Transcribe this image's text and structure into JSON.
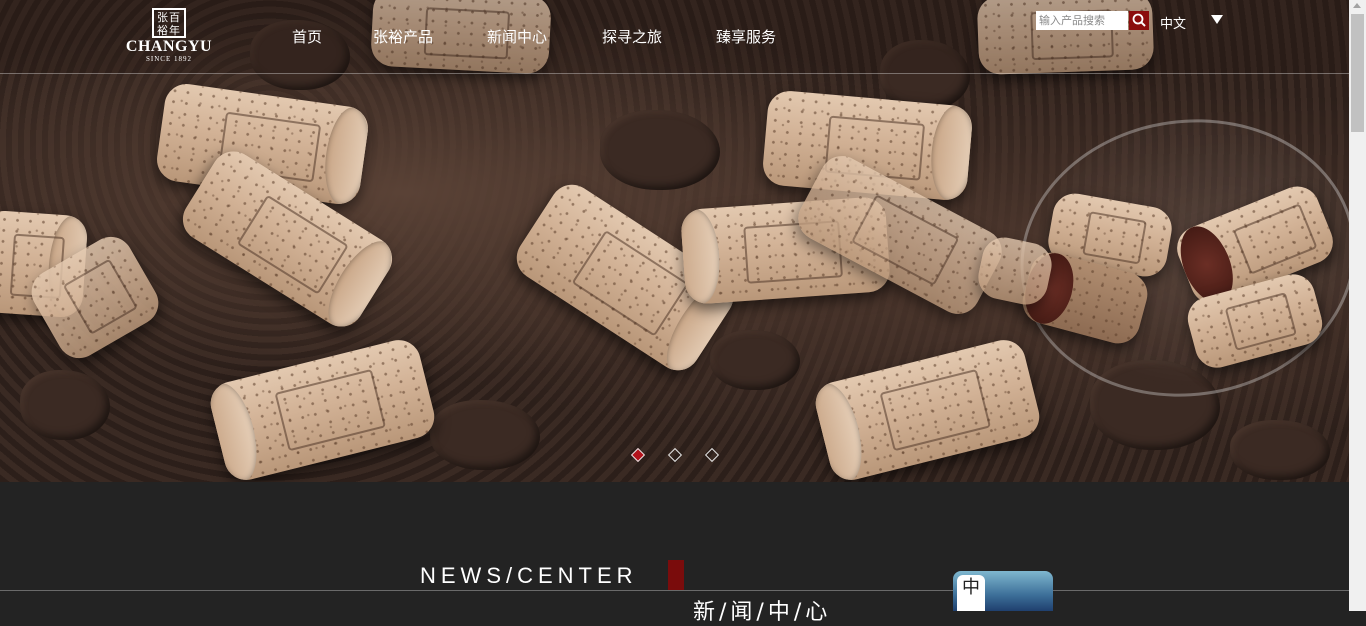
{
  "header": {
    "logo": {
      "mark_text": "张百\n裕年",
      "name": "CHANGYU",
      "since": "SINCE 1892"
    },
    "nav": [
      {
        "label": "首页"
      },
      {
        "label": "张裕产品"
      },
      {
        "label": "新闻中心"
      },
      {
        "label": "探寻之旅"
      },
      {
        "label": "臻享服务"
      }
    ],
    "search": {
      "placeholder": "输入产品搜索",
      "icon": "search-icon"
    },
    "language": {
      "label": "中文",
      "icon": "caret-down-icon"
    }
  },
  "carousel": {
    "slides": 3,
    "active_index": 0,
    "active_color": "#b3121a"
  },
  "news_section": {
    "title_en": "NEWS/CENTER",
    "title_cn": "新/闻/中/心",
    "accent_color": "#7a0c0c"
  },
  "floating_widget": {
    "badge_text": "中"
  }
}
